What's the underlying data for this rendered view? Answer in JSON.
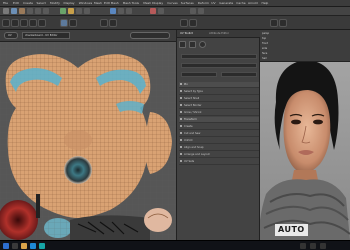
{
  "app": {
    "menu": [
      "File",
      "Edit",
      "Create",
      "Select",
      "Modify",
      "Display",
      "Windows",
      "Mesh",
      "Edit Mesh",
      "Mesh Tools",
      "Mesh Display",
      "Curves",
      "Surfaces",
      "Deform",
      "UV",
      "Generate",
      "Cache",
      "Arnold",
      "Help"
    ],
    "workspace_label": "Workspace: Maya Classic",
    "watermark_text": "AUTO"
  },
  "uv_editor": {
    "tab_label": "checkerboard - UV Editor",
    "toggle_label": "UV"
  },
  "attribute_panel": {
    "tabs": [
      "UV Toolkit",
      "Attribute Editor"
    ],
    "rows": [
      "Pin",
      "Select by Type",
      "Select Shell",
      "Select Border",
      "Grow / Shrink",
      "Transform",
      "Create",
      "Cut and Sew",
      "Unfold",
      "Align and Snap",
      "Arrange and Layout",
      "UV Sets"
    ]
  },
  "outliner": {
    "rows": [
      "persp",
      "top",
      "front",
      "side",
      "face",
      "hair"
    ]
  },
  "colors": {
    "uv_background": "#565656",
    "uv_mesh": "#d9a273",
    "uv_eye_blue": "#5fb0c9",
    "taskbar": "#101217"
  }
}
